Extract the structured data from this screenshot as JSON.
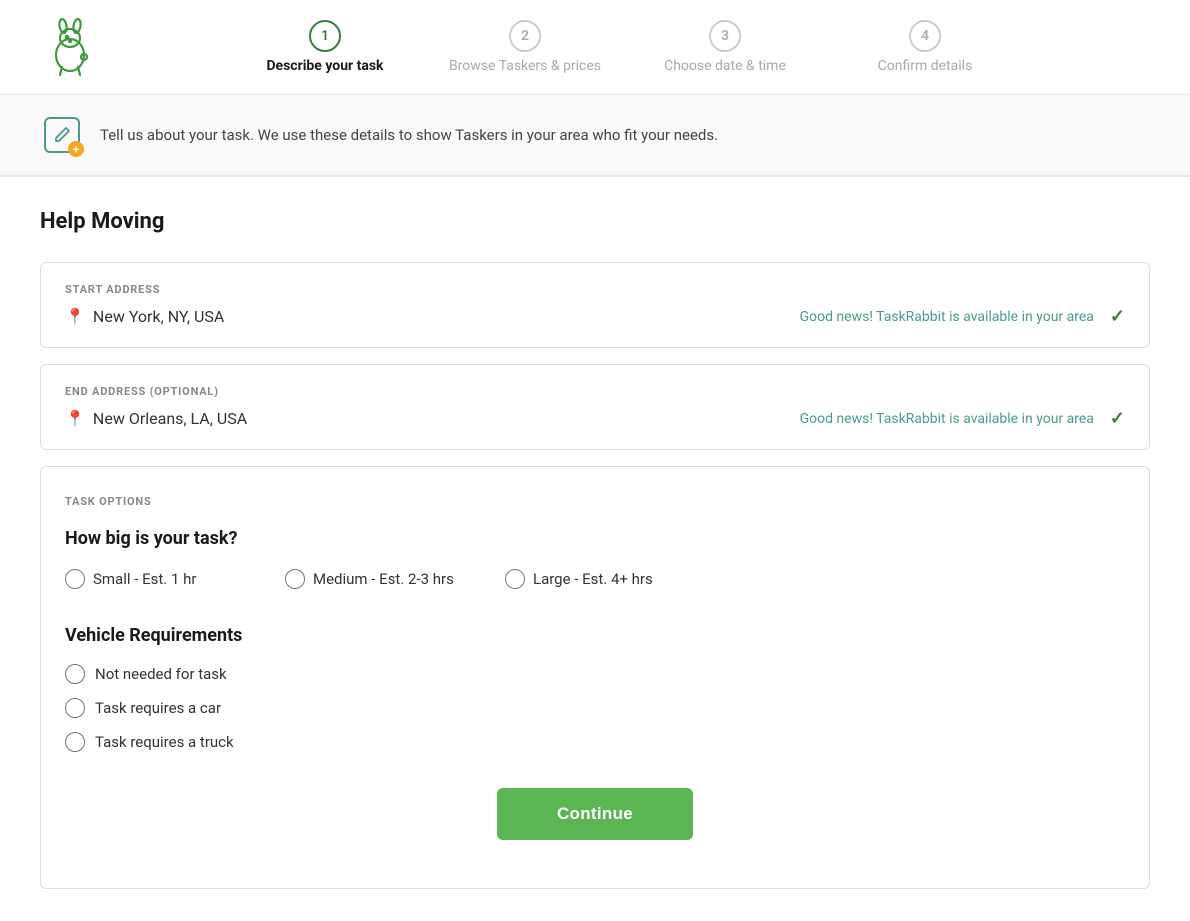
{
  "logo": {
    "alt": "TaskRabbit"
  },
  "stepper": {
    "steps": [
      {
        "number": "1",
        "label": "Describe your task",
        "active": true
      },
      {
        "number": "2",
        "label": "Browse Taskers & prices",
        "active": false
      },
      {
        "number": "3",
        "label": "Choose date & time",
        "active": false
      },
      {
        "number": "4",
        "label": "Confirm details",
        "active": false
      }
    ]
  },
  "info_bar": {
    "text": "Tell us about your task. We use these details to show Taskers in your area who fit your needs."
  },
  "page_title": "Help Moving",
  "start_address": {
    "label": "START ADDRESS",
    "value": "New York, NY, USA",
    "availability": "Good news! TaskRabbit is available in your area"
  },
  "end_address": {
    "label": "END ADDRESS (OPTIONAL)",
    "value": "New Orleans, LA, USA",
    "availability": "Good news! TaskRabbit is available in your area"
  },
  "task_options": {
    "section_label": "TASK OPTIONS",
    "size_question": "How big is your task?",
    "size_options": [
      {
        "id": "small",
        "label": "Small - Est. 1 hr"
      },
      {
        "id": "medium",
        "label": "Medium - Est. 2-3 hrs"
      },
      {
        "id": "large",
        "label": "Large - Est. 4+ hrs"
      }
    ],
    "vehicle_title": "Vehicle Requirements",
    "vehicle_options": [
      {
        "id": "none",
        "label": "Not needed for task"
      },
      {
        "id": "car",
        "label": "Task requires a car"
      },
      {
        "id": "truck",
        "label": "Task requires a truck"
      }
    ]
  },
  "continue_button": {
    "label": "Continue"
  },
  "colors": {
    "accent_green": "#5ab552",
    "teal": "#4a9b8f",
    "orange": "#f5a623",
    "dark_green_check": "#3d7a3d"
  }
}
